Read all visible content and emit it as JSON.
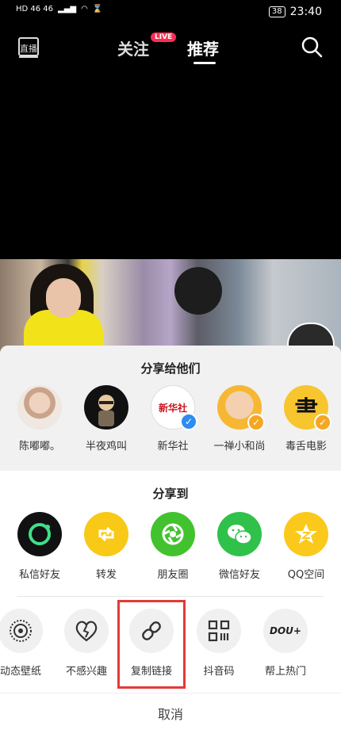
{
  "status_bar": {
    "left": "HD 46 46",
    "battery": "38",
    "time": "23:40"
  },
  "top_nav": {
    "tabs": [
      {
        "label": "关注"
      },
      {
        "label": "推荐"
      }
    ],
    "live_badge": "LIVE",
    "live_icon_label": "直播"
  },
  "share_sheet": {
    "share_to_people_title": "分享给他们",
    "contacts": [
      {
        "name": "陈嘟嘟。"
      },
      {
        "name": "半夜鸡叫"
      },
      {
        "name": "新华社"
      },
      {
        "name": "一禅小和尚"
      },
      {
        "name": "毒舌电影"
      }
    ],
    "share_to_title": "分享到",
    "apps": [
      {
        "label": "私信好友",
        "color": "#111111"
      },
      {
        "label": "转发",
        "color": "#f8c916"
      },
      {
        "label": "朋友圈",
        "color": "#43c22f"
      },
      {
        "label": "微信好友",
        "color": "#2fc14a"
      },
      {
        "label": "QQ空间",
        "color": "#fbc91b"
      }
    ],
    "tools": [
      {
        "label": "动态壁纸"
      },
      {
        "label": "不感兴趣"
      },
      {
        "label": "复制链接"
      },
      {
        "label": "抖音码"
      },
      {
        "label": "帮上热门"
      }
    ],
    "xinhua_logo_text": "新华社",
    "dou_plus_text": "DOU+",
    "cancel_label": "取消"
  }
}
